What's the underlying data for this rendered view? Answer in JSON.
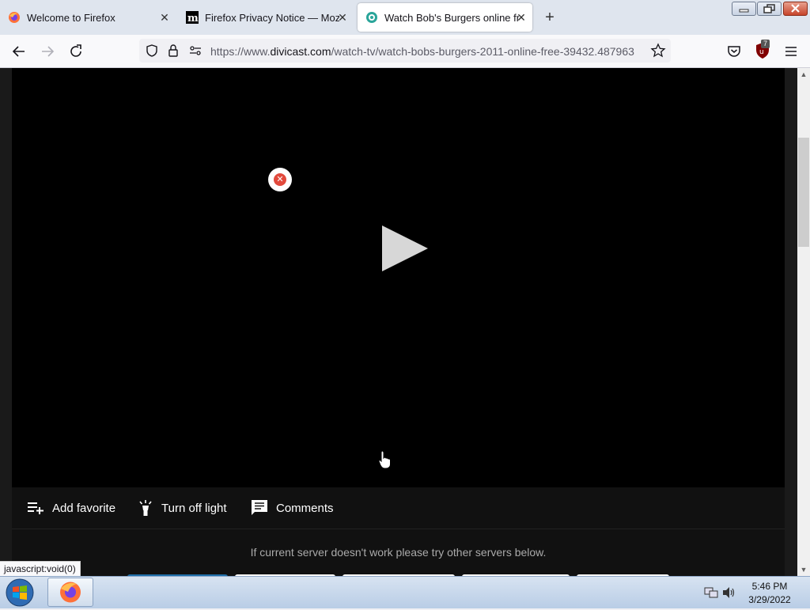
{
  "browser": {
    "tabs": [
      {
        "label": "Welcome to Firefox",
        "close": "✕"
      },
      {
        "label": "Firefox Privacy Notice — Mozilla",
        "close": "✕"
      },
      {
        "label": "Watch Bob's Burgers online free",
        "close": "✕"
      }
    ],
    "selected_tab": 2,
    "new_tab_label": "+",
    "url": {
      "prefix": "https://www.",
      "domain": "divicast.com",
      "path": "/watch-tv/watch-bobs-burgers-2011-online-free-39432.487963"
    },
    "ublock_badge": "7",
    "status_text": "javascript:void(0)"
  },
  "page": {
    "ad_close_label": "✕",
    "actions": [
      {
        "label": "Add favorite",
        "icon": "playlist-add-icon"
      },
      {
        "label": "Turn off light",
        "icon": "lamp-icon"
      },
      {
        "label": "Comments",
        "icon": "comment-icon"
      }
    ],
    "server_note": "If current server doesn't work please try other servers below."
  },
  "taskbar": {
    "time": "5:46 PM",
    "date": "3/29/2022"
  },
  "colors": {
    "tab_strip": "#dfe5ee",
    "player": "#000000",
    "action_bar": "#111111",
    "active_server": "#1f6fa8"
  }
}
